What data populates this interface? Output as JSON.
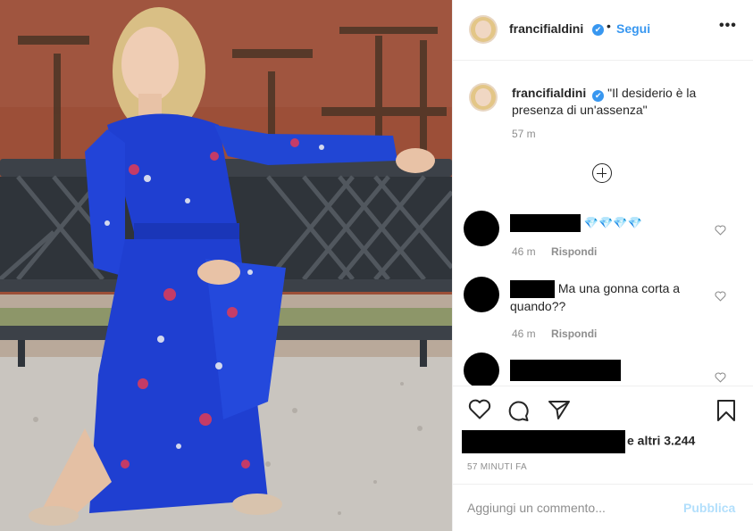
{
  "post": {
    "username": "francifialdini",
    "verified_mark": "✔",
    "separator": "•",
    "follow_label": "Segui",
    "more_label": "•••"
  },
  "caption": {
    "username": "francifialdini",
    "text": "\"Il desiderio è la presenza di un'assenza\"",
    "time": "57 m"
  },
  "comments": [
    {
      "text_after_redaction": "💎💎💎💎",
      "time": "46 m",
      "reply_label": "Rispondi"
    },
    {
      "text_after_redaction": "Ma una gonna corta a quando??",
      "time": "46 m",
      "reply_label": "Rispondi"
    },
    {
      "text_after_redaction": "",
      "time": "",
      "reply_label": ""
    }
  ],
  "likes": {
    "suffix": "e altri 3.244"
  },
  "posted_ago": "57 MINUTI FA",
  "add_comment": {
    "placeholder": "Aggiungi un commento...",
    "publish_label": "Pubblica"
  },
  "colors": {
    "accent": "#3897f0",
    "publish_disabled": "#b2dffc",
    "muted": "#8e8e8e",
    "dress": "#1f3fd1"
  },
  "icons": [
    "more-icon",
    "load-more-icon",
    "heart-icon",
    "comment-icon",
    "share-icon",
    "bookmark-icon",
    "verified-icon"
  ]
}
